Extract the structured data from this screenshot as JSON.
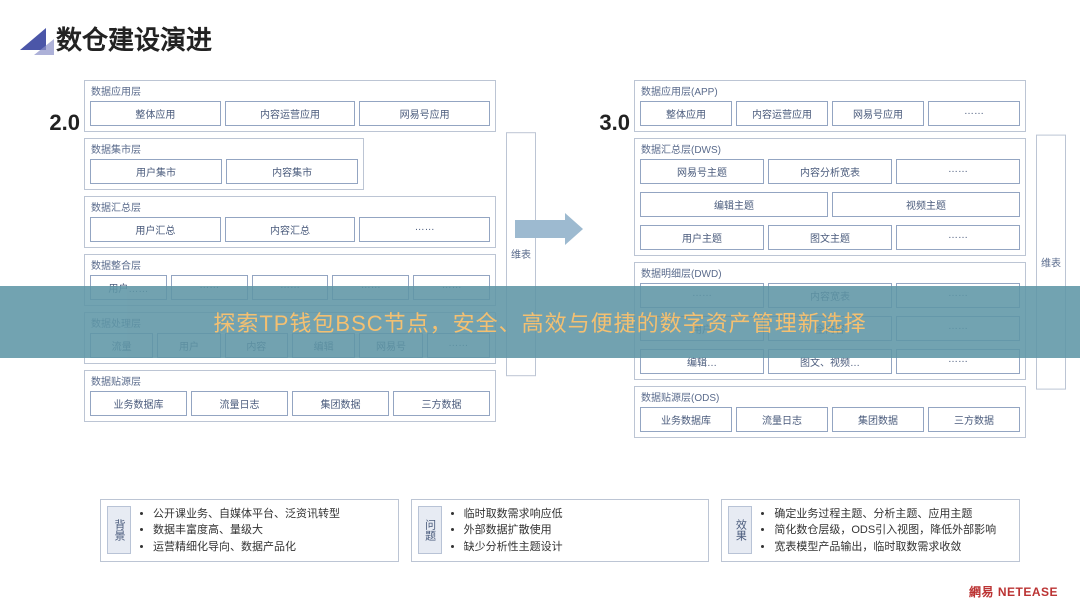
{
  "title": "数仓建设演进",
  "version_left": "2.0",
  "version_right": "3.0",
  "side_tag": "维表",
  "overlay": "探索TP钱包BSC节点，安全、高效与便捷的数字资产管理新选择",
  "brand": "網易 NETEASE",
  "left": {
    "layers": [
      {
        "title": "数据应用层",
        "short": false,
        "cells": [
          "整体应用",
          "内容运营应用",
          "网易号应用"
        ]
      },
      {
        "title": "数据集市层",
        "short": true,
        "cells": [
          "用户集市",
          "内容集市"
        ]
      },
      {
        "title": "数据汇总层",
        "short": false,
        "cells": [
          "用户汇总",
          "内容汇总",
          "……"
        ]
      },
      {
        "title": "数据整合层",
        "short": false,
        "cells": [
          "用户……",
          "……",
          "……",
          "……",
          "……"
        ]
      },
      {
        "title": "数据处理层",
        "short": false,
        "cells": [
          "流量",
          "用户",
          "内容",
          "编辑",
          "网易号",
          "……"
        ]
      },
      {
        "title": "数据贴源层",
        "short": false,
        "cells": [
          "业务数据库",
          "流量日志",
          "集团数据",
          "三方数据"
        ]
      }
    ]
  },
  "right": {
    "layers": [
      {
        "title": "数据应用层(APP)",
        "cells": [
          "整体应用",
          "内容运营应用",
          "网易号应用",
          "……"
        ]
      },
      {
        "title": "数据汇总层(DWS)",
        "rows": [
          [
            "网易号主题",
            "内容分析宽表",
            "……"
          ],
          [
            "编辑主题",
            "视频主题"
          ],
          [
            "用户主题",
            "图文主题",
            "……"
          ]
        ]
      },
      {
        "title": "数据明细层(DWD)",
        "rows": [
          [
            "……",
            "内容宽表",
            "……"
          ],
          [
            "用户",
            "全内容",
            "……"
          ],
          [
            "编辑…",
            "图文、视频…",
            "……"
          ]
        ]
      },
      {
        "title": "数据贴源层(ODS)",
        "cells": [
          "业务数据库",
          "流量日志",
          "集团数据",
          "三方数据"
        ]
      }
    ]
  },
  "footer": [
    {
      "tag": "背景",
      "items": [
        "公开课业务、自媒体平台、泛资讯转型",
        "数据丰富度高、量级大",
        "运营精细化导向、数据产品化"
      ]
    },
    {
      "tag": "问题",
      "items": [
        "临时取数需求响应低",
        "外部数据扩散使用",
        "缺少分析性主题设计"
      ]
    },
    {
      "tag": "效果",
      "items": [
        "确定业务过程主题、分析主题、应用主题",
        "简化数仓层级，ODS引入视图，降低外部影响",
        "宽表模型产品输出，临时取数需求收敛"
      ]
    }
  ]
}
